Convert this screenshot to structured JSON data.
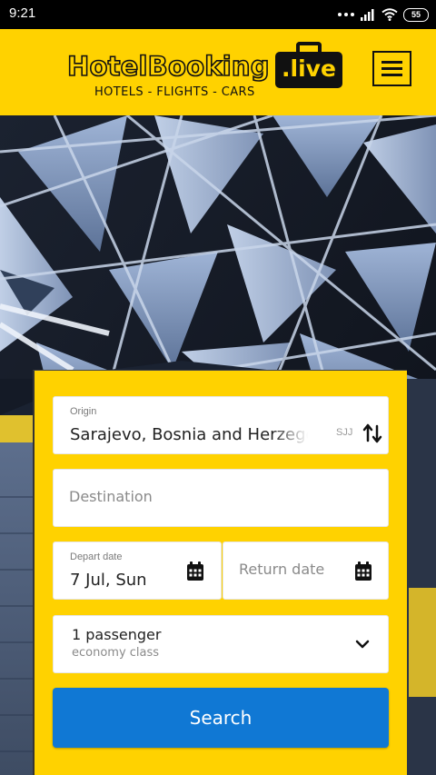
{
  "status_bar": {
    "time": "9:21",
    "battery": "55",
    "icons": [
      "more-dots-icon",
      "signal-icon",
      "wifi-icon",
      "battery-icon"
    ]
  },
  "header": {
    "logo_main": "HotelBooking",
    "logo_tld": ".live",
    "logo_tagline": "HOTELS - FLIGHTS - CARS",
    "menu_icon": "hamburger-menu-icon",
    "background_color": "#ffd200"
  },
  "search_form": {
    "origin": {
      "label": "Origin",
      "value": "Sarajevo, Bosnia and Herzegovina",
      "code": "SJJ",
      "swap_icon": "swap-arrows-icon"
    },
    "destination": {
      "placeholder": "Destination"
    },
    "depart": {
      "label": "Depart date",
      "value": "7 Jul, Sun",
      "icon": "calendar-icon"
    },
    "return": {
      "placeholder": "Return date",
      "icon": "calendar-icon"
    },
    "passengers": {
      "count_text": "1 passenger",
      "class_text": "economy class",
      "icon": "chevron-down-icon"
    },
    "search_button": "Search",
    "colors": {
      "card": "#ffd200",
      "button": "#1078d4"
    }
  }
}
